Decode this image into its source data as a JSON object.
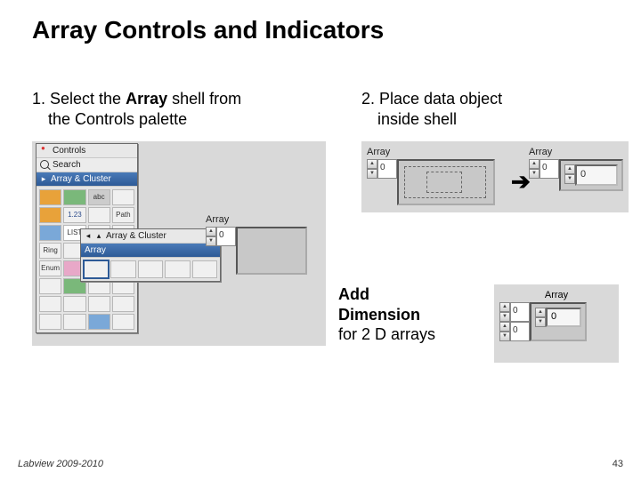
{
  "title": "Array Controls and Indicators",
  "step1": {
    "prefix": "1. Select the ",
    "bold": "Array",
    "after": " shell from",
    "line2": "the Controls palette"
  },
  "step2": {
    "prefix": "2. Place data object",
    "line2": "inside shell"
  },
  "palette": {
    "controls_label": "Controls",
    "search_label": "Search",
    "group_label": "Array & Cluster",
    "sub_group_label": "Array & Cluster",
    "array_label": "Array",
    "cells": {
      "num": "1.23",
      "abc": "abc",
      "path": "Path",
      "list": "LIST",
      "ring": "Ring",
      "enum": "Enum"
    }
  },
  "step1_array": {
    "label": "Array",
    "index": "0"
  },
  "step2_drag": {
    "label": "Array",
    "index": "0"
  },
  "step2_result": {
    "label": "Array",
    "index": "0",
    "value": "0"
  },
  "add_dim": {
    "line1a": "Add",
    "line1b": "Dimension",
    "line2": "for 2 D arrays"
  },
  "d2": {
    "label": "Array",
    "index0": "0",
    "index1": "0",
    "value": "0"
  },
  "arrow": "➔",
  "footer": {
    "left": "Labview 2009-2010",
    "right": "43"
  }
}
